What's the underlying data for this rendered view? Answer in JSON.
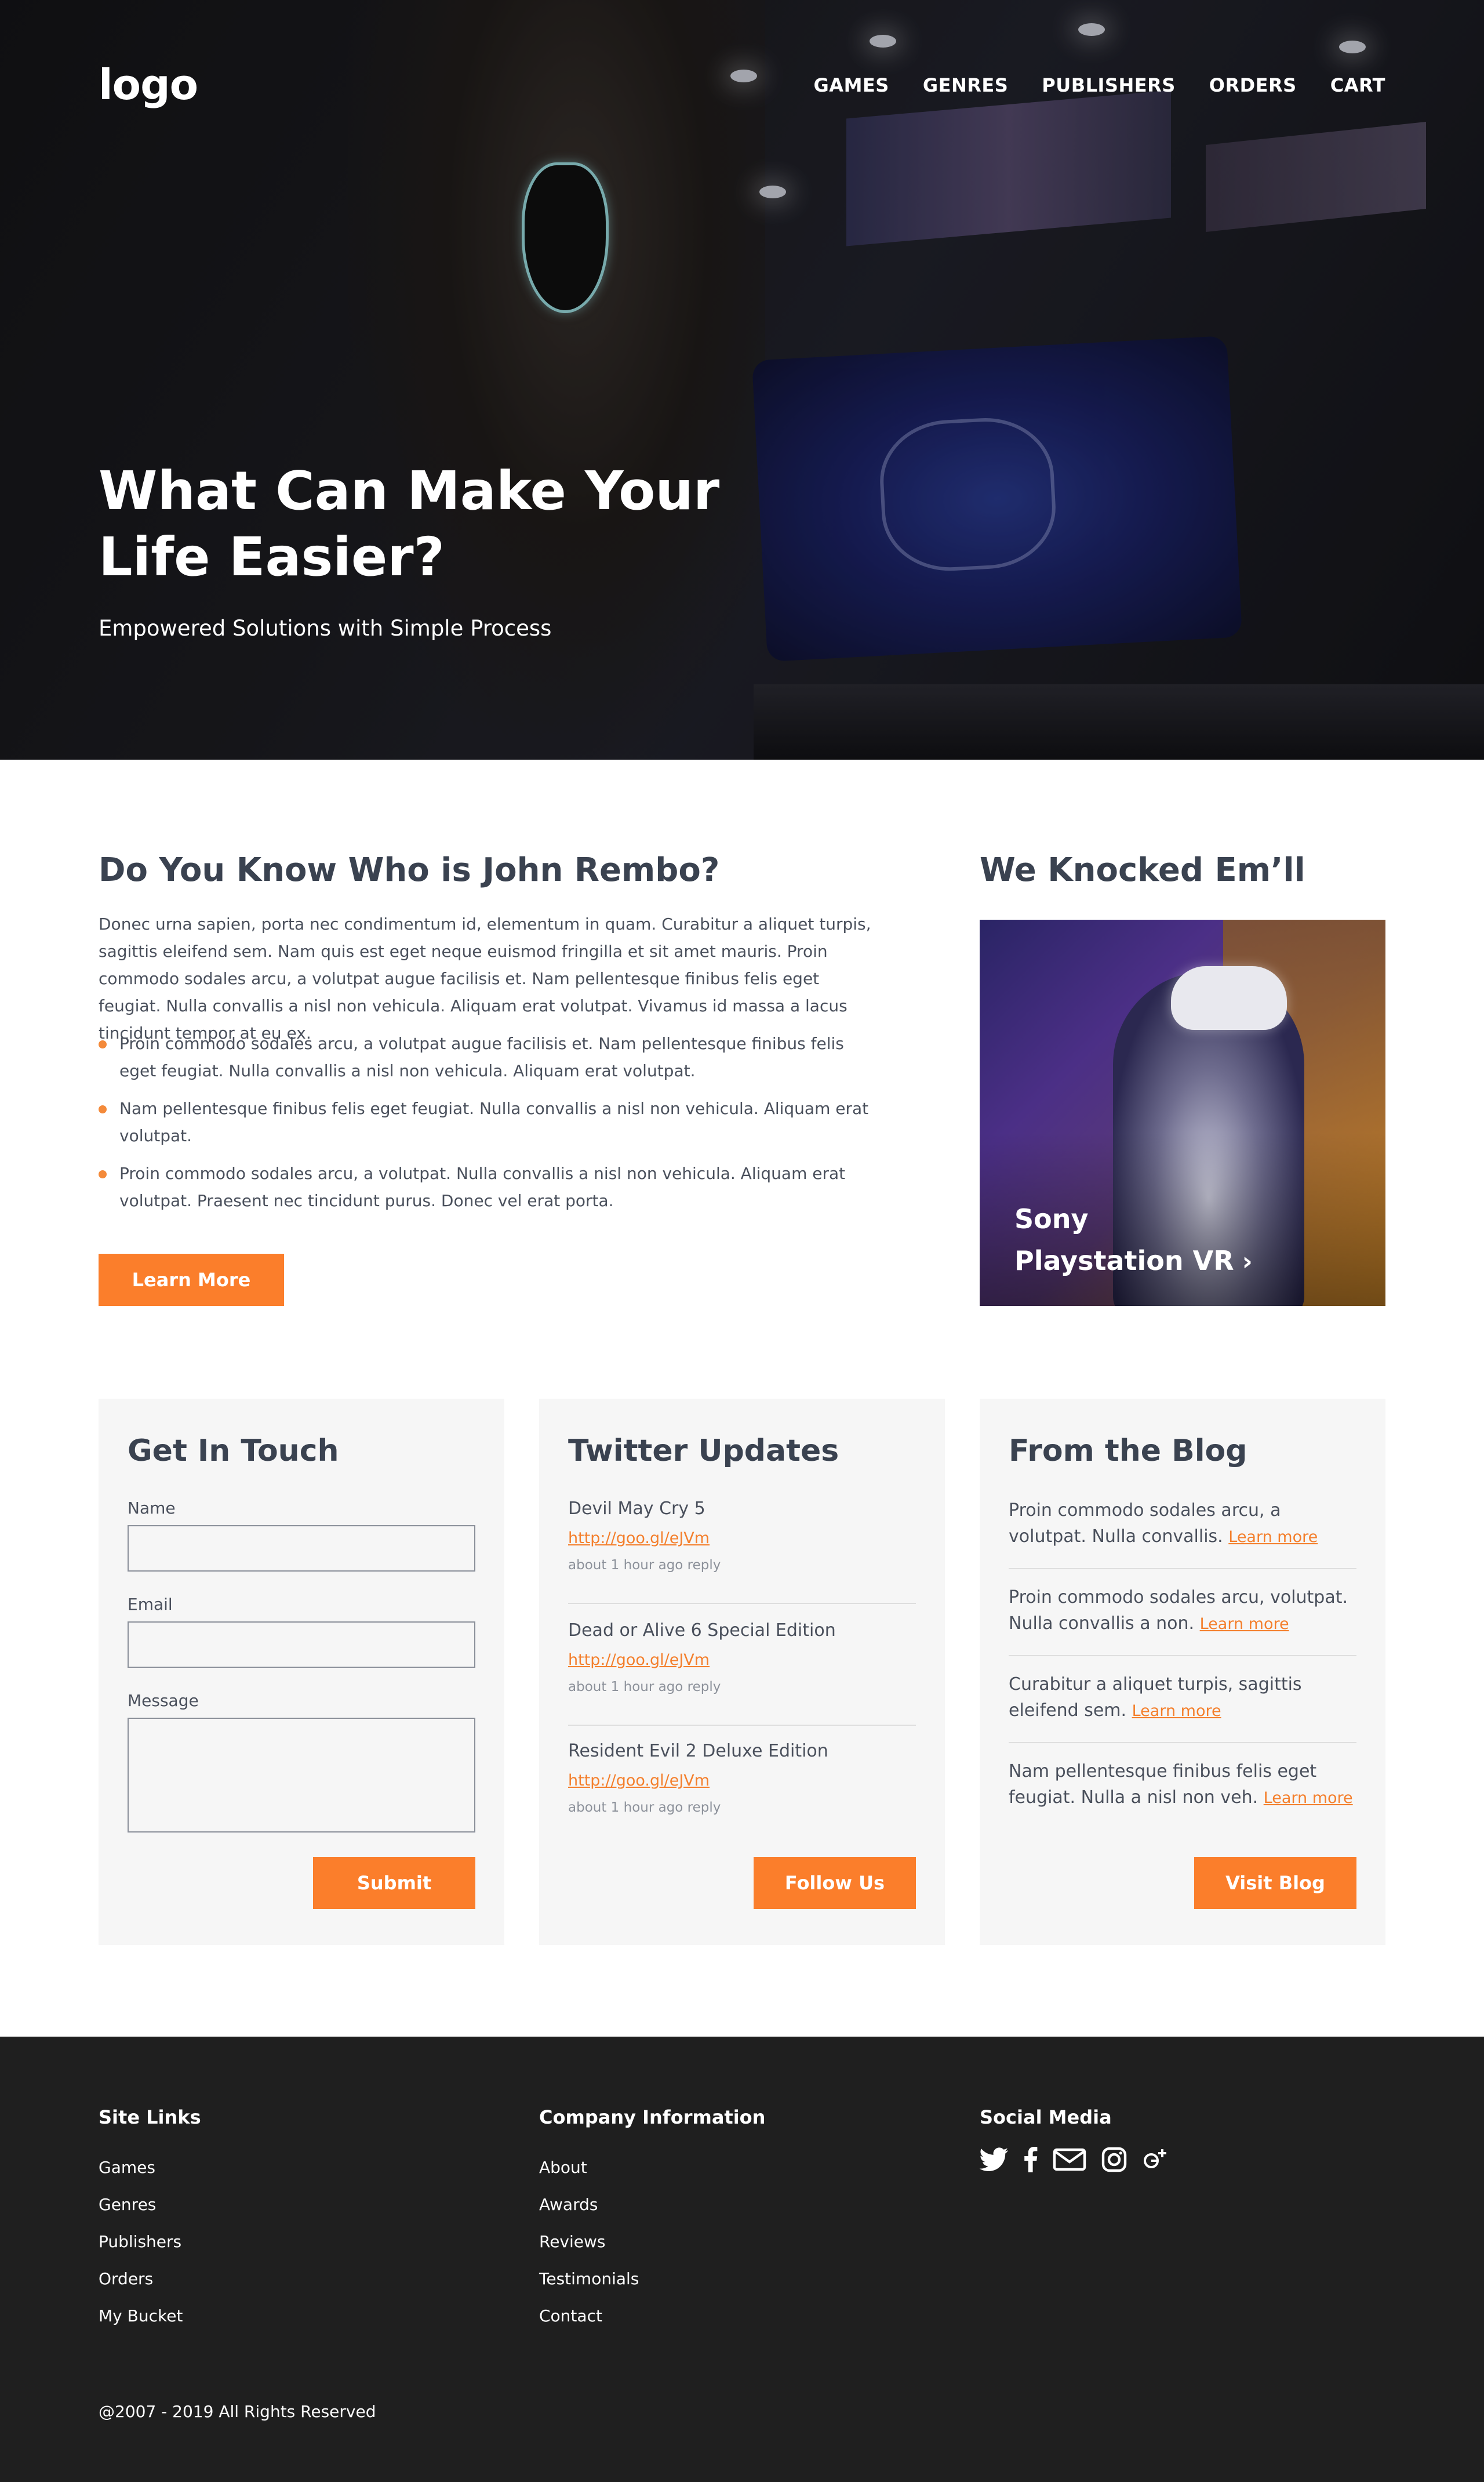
{
  "header": {
    "logo": "logo",
    "nav": [
      "GAMES",
      "GENRES",
      "PUBLISHERS",
      "ORDERS",
      "CART"
    ]
  },
  "hero": {
    "title": "What Can Make Your Life Easier?",
    "subtitle": "Empowered Solutions with Simple Process"
  },
  "about": {
    "title": "Do You Know Who is John Rembo?",
    "body": "Donec urna sapien, porta nec condimentum id, elementum in quam. Curabitur a aliquet turpis, sagittis eleifend sem. Nam quis est eget neque euismod fringilla et sit amet mauris. Proin commodo sodales arcu, a volutpat augue facilisis et. Nam pellentesque finibus felis eget feugiat. Nulla convallis a nisl non vehicula. Aliquam erat volutpat. Vivamus id massa a lacus tincidunt tempor at eu ex.",
    "bullets": [
      "Proin commodo sodales arcu, a volutpat augue facilisis et. Nam pellentesque finibus felis eget feugiat. Nulla convallis a nisl non vehicula. Aliquam erat volutpat.",
      "Nam pellentesque finibus felis eget feugiat. Nulla convallis a nisl non vehicula. Aliquam erat volutpat.",
      "Proin commodo sodales arcu, a volutpat. Nulla convallis a nisl non vehicula. Aliquam erat volutpat. Praesent nec tincidunt purus. Donec vel erat porta."
    ],
    "button": "Learn More"
  },
  "featured": {
    "title": "We Knocked Em’ll",
    "caption_line1": "Sony",
    "caption_line2": "Playstation VR"
  },
  "contact": {
    "title": "Get In Touch",
    "name_label": "Name",
    "email_label": "Email",
    "message_label": "Message",
    "button": "Submit"
  },
  "twitter": {
    "title": "Twitter Updates",
    "items": [
      {
        "text": "Devil May Cry 5",
        "link": "http://goo.gl/eJVm",
        "meta": "about 1 hour ago reply"
      },
      {
        "text": "Dead or Alive 6 Special Edition",
        "link": "http://goo.gl/eJVm",
        "meta": "about 1 hour ago reply"
      },
      {
        "text": "Resident Evil 2 Deluxe Edition",
        "link": "http://goo.gl/eJVm",
        "meta": "about 1 hour ago reply"
      }
    ],
    "button": "Follow Us"
  },
  "blog": {
    "title": "From the Blog",
    "items": [
      {
        "text": "Proin commodo sodales arcu, a volutpat. Nulla convallis.",
        "link": "Learn more"
      },
      {
        "text": "Proin commodo sodales arcu, volutpat. Nulla convallis a non.",
        "link": "Learn more"
      },
      {
        "text": "Curabitur a aliquet turpis, sagittis eleifend sem.",
        "link": "Learn more"
      },
      {
        "text": "Nam pellentesque finibus felis eget feugiat. Nulla a nisl non veh.",
        "link": "Learn more"
      }
    ],
    "button": "Visit Blog"
  },
  "footer": {
    "site_links": {
      "title": "Site Links",
      "items": [
        "Games",
        "Genres",
        "Publishers",
        "Orders",
        "My Bucket"
      ]
    },
    "company": {
      "title": "Company Information",
      "items": [
        "About",
        "Awards",
        "Reviews",
        "Testimonials",
        "Contact"
      ]
    },
    "social": {
      "title": "Social Media",
      "icons": [
        "twitter-icon",
        "facebook-icon",
        "mail-icon",
        "instagram-icon",
        "google-plus-icon"
      ]
    },
    "copyright": "@2007 - 2019 All Rights Reserved"
  },
  "colors": {
    "accent": "#fb7e2b",
    "heading": "#3a4250",
    "card_bg": "#f6f6f6",
    "footer_bg": "#1f1f1f"
  }
}
